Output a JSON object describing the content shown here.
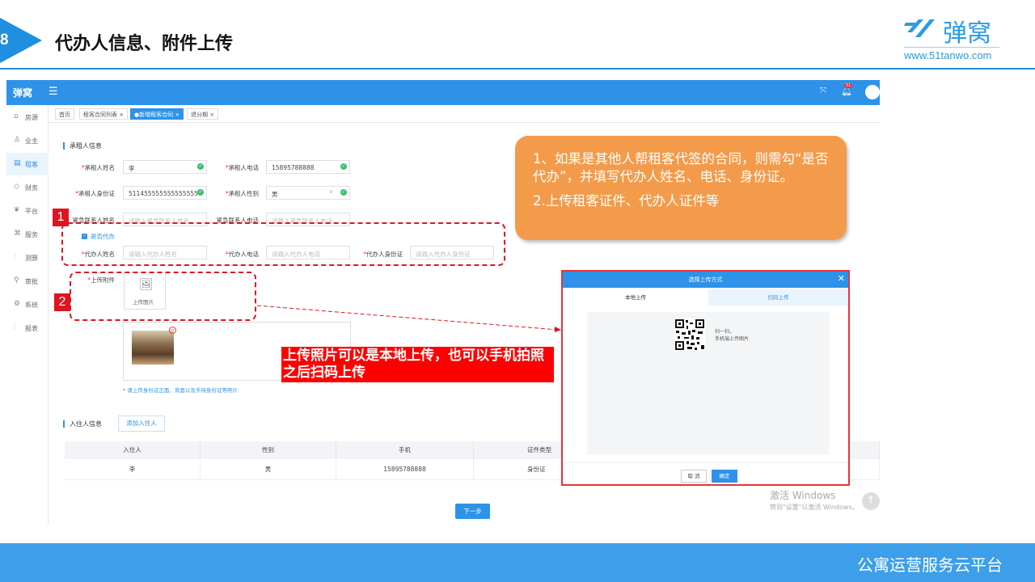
{
  "slide": {
    "number": "8",
    "title": "代办人信息、附件上传",
    "logo_text": "弹窝",
    "logo_url": "www.51tanwo.com",
    "footer": "公寓运营服务云平台"
  },
  "app": {
    "brand": "弹窝",
    "notification_count": "51",
    "sidebar": [
      "房源",
      "业主",
      "租客",
      "财务",
      "平台",
      "服务",
      "测算",
      "审批",
      "系统",
      "报表"
    ],
    "tabs": [
      "首页",
      "租客合同列表 ×",
      "●新增租客合同 ×",
      "退分期 ×"
    ],
    "section_renter": "承租人信息",
    "renter": {
      "name_label": "承租人姓名",
      "name_value": "李",
      "phone_label": "承租人电话",
      "phone_value": "15895788888",
      "id_label": "承租人身份证",
      "id_value": "511455555555555555",
      "gender_label": "承租人性别",
      "gender_value": "男",
      "emergency_name_label": "紧急联系人姓名",
      "emergency_name_placeholder": "请输入紧急联系人姓名",
      "emergency_phone_label": "紧急联系人电话",
      "emergency_phone_placeholder": "请输入紧急联系人电话"
    },
    "agent": {
      "checkbox_label": "是否代办",
      "name_label": "代办人姓名",
      "name_placeholder": "请输入代办人姓名",
      "phone_label": "代办人电话",
      "phone_placeholder": "请输入代办人电话",
      "id_label": "代办人身份证",
      "id_placeholder": "请输入代办人身份证"
    },
    "attachment_label": "上传附件",
    "upload_button": "上传图片",
    "upload_hint": "* 请上传身份证正面、背面以及手持身份证等照片",
    "section_residents": "入住人信息",
    "add_resident": "添加入住人",
    "table": {
      "headers": [
        "入住人",
        "性别",
        "手机",
        "证件类型"
      ],
      "rows": [
        [
          "李",
          "男",
          "15895788888",
          "身份证"
        ]
      ]
    },
    "next_button": "下一步"
  },
  "annotations": {
    "badge1": "1",
    "badge2": "2",
    "callout_line1": "1、如果是其他人帮租客代签的合同，则需勾“是否代办”，并填写代办人姓名、电话、身份证。",
    "callout_line2": "2.上传租客证件、代办人证件等",
    "red_note": "上传照片可以是本地上传，也可以手机拍照之后扫码上传"
  },
  "dialog": {
    "title": "选择上传方式",
    "tab_local": "本地上传",
    "tab_scan": "扫码上传",
    "scan_line1": "扫一扫，",
    "scan_line2": "手机端上传图片",
    "cancel": "取 消",
    "confirm": "确定"
  },
  "watermark": {
    "line1": "激活 Windows",
    "line2": "转到\"设置\"以激活 Windows。"
  },
  "colors": {
    "accent": "#2e92e8",
    "callout": "#f39b4a",
    "alert": "#e0141e"
  }
}
